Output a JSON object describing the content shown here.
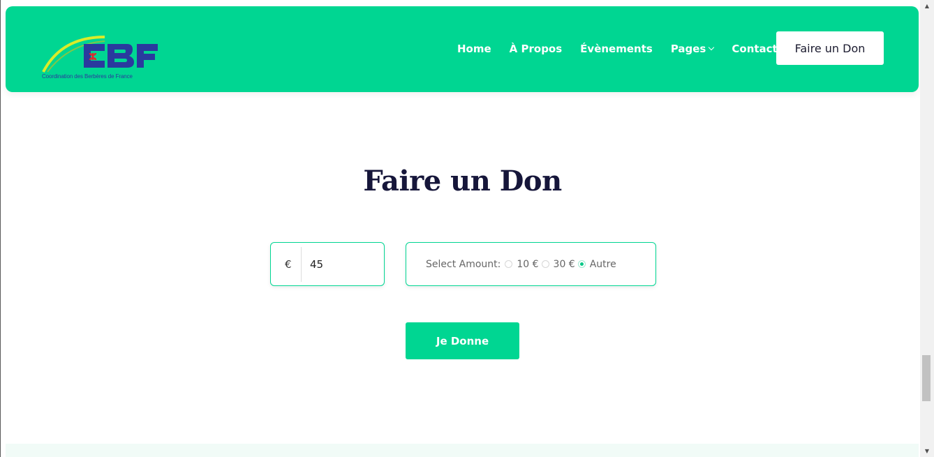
{
  "header": {
    "logo": {
      "letters": "CBF",
      "caption": "Coordination des Berbères de France"
    },
    "nav": [
      {
        "label": "Home"
      },
      {
        "label": "À Propos"
      },
      {
        "label": "Évènements"
      },
      {
        "label": "Pages"
      },
      {
        "label": "Contact"
      }
    ],
    "cta_label": "Faire un Don"
  },
  "main": {
    "title": "Faire un Don",
    "amount": {
      "currency": "€",
      "value": "45"
    },
    "select": {
      "label": "Select Amount:",
      "options": [
        {
          "label": "10 €",
          "checked": false
        },
        {
          "label": "30 €",
          "checked": false
        },
        {
          "label": "Autre",
          "checked": true
        }
      ]
    },
    "submit_label": "Je Donne"
  },
  "colors": {
    "brand_green": "#00d692",
    "title": "#16163a",
    "logo_blue": "#2a3a9e"
  },
  "icons": {
    "pages_dropdown": "chevron-down-icon",
    "scroll_up": "scroll-up-arrow-icon",
    "scroll_down": "scroll-down-arrow-icon"
  }
}
